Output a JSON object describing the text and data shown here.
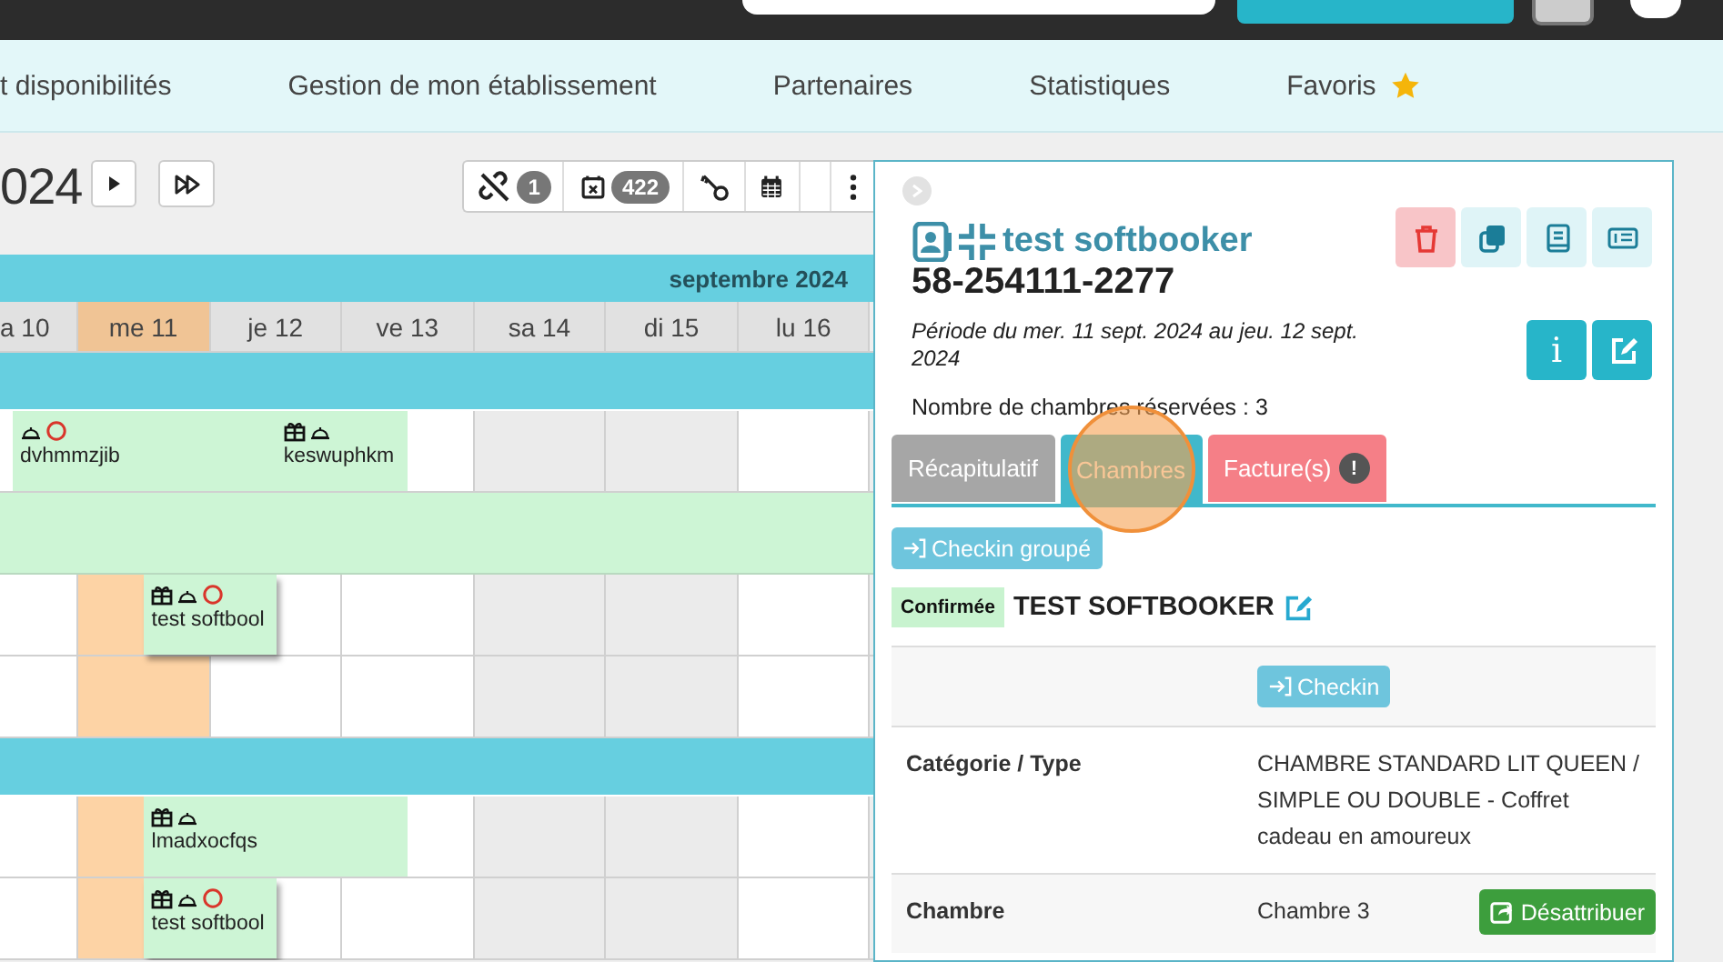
{
  "nav": {
    "items": [
      {
        "label": "t disponibilités",
        "favorite": false
      },
      {
        "label": "Gestion de mon établissement",
        "favorite": false
      },
      {
        "label": "Partenaires",
        "favorite": false
      },
      {
        "label": "Statistiques",
        "favorite": false
      },
      {
        "label": "Favoris",
        "favorite": true
      }
    ]
  },
  "calendar": {
    "year": "024",
    "month": "septembre 2024",
    "tools": [
      {
        "kind": "unlink",
        "count": "1"
      },
      {
        "kind": "cancelled",
        "count": "422"
      },
      {
        "kind": "key"
      },
      {
        "kind": "calendar"
      },
      {
        "kind": "blank"
      },
      {
        "kind": "menu"
      }
    ],
    "days": [
      {
        "label": "a 10",
        "today": false,
        "weekend": false
      },
      {
        "label": "me 11",
        "today": true,
        "weekend": false
      },
      {
        "label": "je 12",
        "today": false,
        "weekend": false
      },
      {
        "label": "ve 13",
        "today": false,
        "weekend": false
      },
      {
        "label": "sa 14",
        "today": false,
        "weekend": true
      },
      {
        "label": "di 15",
        "today": false,
        "weekend": true
      },
      {
        "label": "lu 16",
        "today": false,
        "weekend": false
      }
    ],
    "rows": [
      {
        "kind": "category"
      },
      {
        "kind": "room",
        "slots": [
          {
            "kind": "booking",
            "label": "dvhmmzjib",
            "two_nights": true,
            "gift": false,
            "service": true,
            "pending": true,
            "selected": false
          },
          {
            "kind": "free"
          },
          {
            "kind": "booking",
            "label": "keswuphkm",
            "two_nights": false,
            "gift": true,
            "service": true,
            "pending": false,
            "selected": false
          },
          {
            "kind": "free"
          },
          {
            "kind": "free"
          },
          {
            "kind": "free"
          },
          {
            "kind": "free"
          }
        ]
      },
      {
        "kind": "group"
      },
      {
        "kind": "room",
        "slots": [
          {
            "kind": "free"
          },
          {
            "kind": "booking",
            "label": "test softbool",
            "two_nights": false,
            "gift": true,
            "service": true,
            "pending": true,
            "selected": true
          },
          {
            "kind": "free"
          },
          {
            "kind": "free"
          },
          {
            "kind": "free"
          },
          {
            "kind": "free"
          },
          {
            "kind": "free"
          }
        ]
      },
      {
        "kind": "room",
        "slots": [
          {
            "kind": "free"
          },
          {
            "kind": "free"
          },
          {
            "kind": "free"
          },
          {
            "kind": "free"
          },
          {
            "kind": "free"
          },
          {
            "kind": "free"
          },
          {
            "kind": "free"
          }
        ]
      },
      {
        "kind": "category"
      },
      {
        "kind": "room",
        "slots": [
          {
            "kind": "free"
          },
          {
            "kind": "booking",
            "label": "lmadxocfqs",
            "two_nights": true,
            "gift": true,
            "service": true,
            "pending": false,
            "selected": false
          },
          {
            "kind": "free"
          },
          {
            "kind": "free"
          },
          {
            "kind": "free"
          },
          {
            "kind": "free"
          },
          {
            "kind": "free"
          }
        ]
      },
      {
        "kind": "room",
        "slots": [
          {
            "kind": "free"
          },
          {
            "kind": "booking",
            "label": "test softbool",
            "two_nights": false,
            "gift": true,
            "service": true,
            "pending": true,
            "selected": true
          },
          {
            "kind": "free"
          },
          {
            "kind": "free"
          },
          {
            "kind": "free"
          },
          {
            "kind": "free"
          },
          {
            "kind": "free"
          }
        ]
      }
    ]
  },
  "booking": {
    "name": "test softbooker",
    "number": "58-254111-2277",
    "period": "Période du mer. 11 sept. 2024 au jeu. 12 sept. 2024",
    "rooms_count": "Nombre de chambres réservées : 3",
    "actions": [
      {
        "kind": "delete"
      },
      {
        "kind": "copy"
      },
      {
        "kind": "book"
      },
      {
        "kind": "invoice"
      },
      {
        "kind": "info",
        "label": "i"
      },
      {
        "kind": "edit"
      }
    ],
    "tabs": [
      {
        "label": "Récapitulatif",
        "selected": false,
        "color": "#a6a6a6",
        "touched": false
      },
      {
        "label": "Chambres",
        "selected": true,
        "color": "#41b8cb",
        "touched": true
      },
      {
        "label": "Facture(s)",
        "selected": false,
        "color": "#f57f87",
        "touched": false,
        "alert": "!"
      }
    ],
    "group_checkin": "Checkin groupé",
    "room": {
      "status": "Confirmée",
      "guest": "TEST SOFTBOOKER",
      "checkin": "Checkin",
      "fields": [
        {
          "label": "Catégorie / Type",
          "value": "CHAMBRE STANDARD LIT QUEEN / SIMPLE OU DOUBLE - Coffret cadeau en amoureux"
        },
        {
          "label": "Chambre",
          "value": "Chambre 3",
          "action": "Désattribuer"
        }
      ]
    }
  }
}
